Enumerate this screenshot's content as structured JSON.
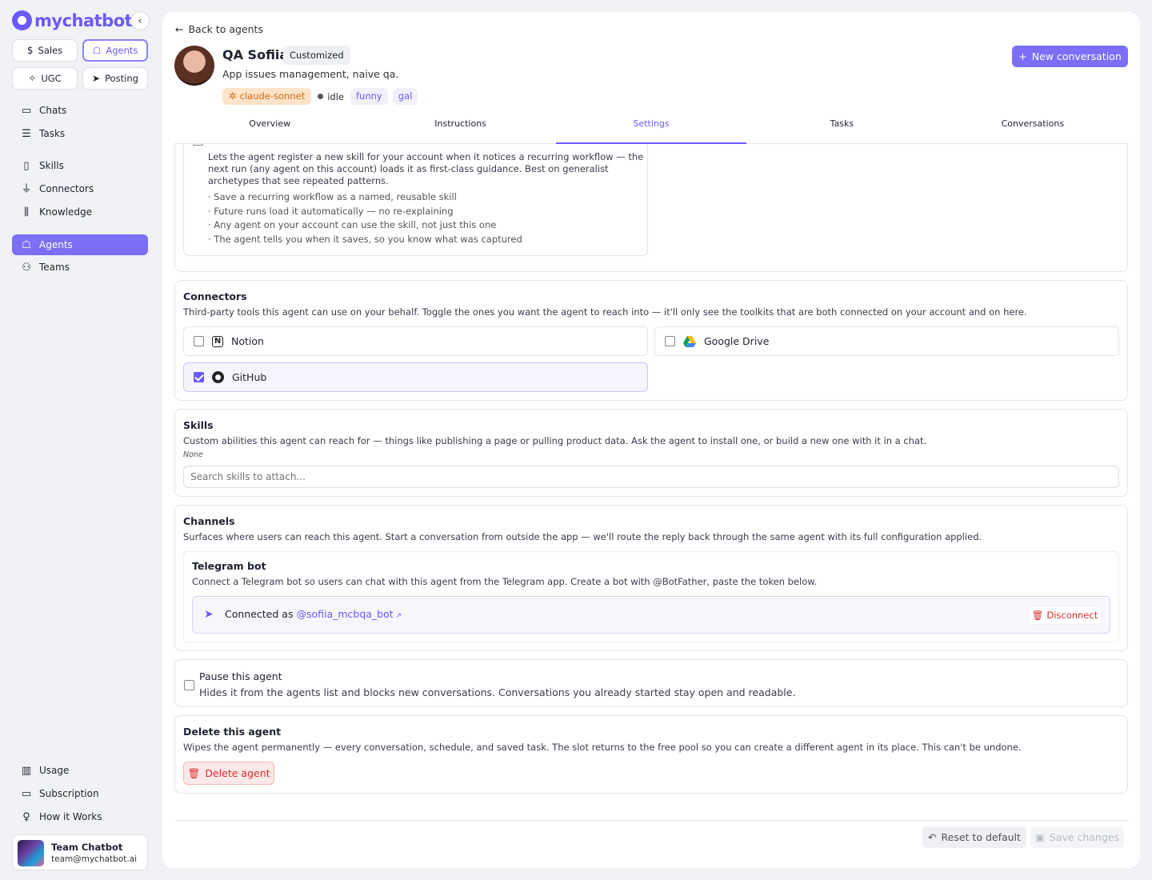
{
  "app": {
    "logo_text": "mychatbot"
  },
  "sidebar": {
    "quick": [
      {
        "label": "Sales",
        "icon": "dollar-icon"
      },
      {
        "label": "Agents",
        "icon": "robot-icon"
      },
      {
        "label": "UGC",
        "icon": "sparkles-icon"
      },
      {
        "label": "Posting",
        "icon": "send-icon"
      }
    ],
    "nav": [
      {
        "label": "Chats",
        "icon": "chat-icon"
      },
      {
        "label": "Tasks",
        "icon": "tasks-icon"
      },
      {
        "label": "Skills",
        "icon": "book-icon"
      },
      {
        "label": "Connectors",
        "icon": "plug-icon"
      },
      {
        "label": "Knowledge",
        "icon": "library-icon"
      },
      {
        "label": "Agents",
        "icon": "robot-icon"
      },
      {
        "label": "Teams",
        "icon": "users-icon"
      }
    ],
    "bottom": [
      {
        "label": "Usage",
        "icon": "bar-chart-icon"
      },
      {
        "label": "Subscription",
        "icon": "credit-card-icon"
      },
      {
        "label": "How it Works",
        "icon": "lightbulb-icon"
      }
    ],
    "profile": {
      "name": "Team Chatbot",
      "email": "team@mychatbot.ai"
    }
  },
  "header": {
    "back_label": "Back to agents",
    "agent_name": "QA Sofiia",
    "badge": "Customized",
    "description": "App issues management, naive qa.",
    "model": "claude-sonnet",
    "status": "idle",
    "tags": [
      "funny",
      "gal"
    ],
    "new_conversation": "New conversation"
  },
  "tabs": [
    "Overview",
    "Instructions",
    "Settings",
    "Tasks",
    "Conversations"
  ],
  "active_tab": "Settings",
  "self_skill": {
    "description": "Lets the agent register a new skill for your account when it notices a recurring workflow — the next run (any agent on this account) loads it as first-class guidance. Best on generalist archetypes that see repeated patterns.",
    "bullets": [
      "· Save a recurring workflow as a named, reusable skill",
      "· Future runs load it automatically — no re-explaining",
      "· Any agent on your account can use the skill, not just this one",
      "· The agent tells you when it saves, so you know what was captured"
    ]
  },
  "connectors": {
    "title": "Connectors",
    "description": "Third-party tools this agent can use on your behalf. Toggle the ones you want the agent to reach into — it'll only see the toolkits that are both connected on your account and on here.",
    "items": [
      {
        "label": "Notion",
        "checked": false
      },
      {
        "label": "Google Drive",
        "checked": false
      },
      {
        "label": "GitHub",
        "checked": true
      }
    ]
  },
  "skills": {
    "title": "Skills",
    "description": "Custom abilities this agent can reach for — things like publishing a page or pulling product data. Ask the agent to install one, or build a new one with it in a chat.",
    "empty": "None",
    "search_placeholder": "Search skills to attach..."
  },
  "channels": {
    "title": "Channels",
    "description": "Surfaces where users can reach this agent. Start a conversation from outside the app — we'll route the reply back through the same agent with its full configuration applied.",
    "telegram": {
      "title": "Telegram bot",
      "description": "Connect a Telegram bot so users can chat with this agent from the Telegram app. Create a bot with @BotFather, paste the token below.",
      "connected_prefix": "Connected as ",
      "handle": "@sofiia_mcbqa_bot",
      "disconnect": "Disconnect"
    }
  },
  "pause": {
    "title": "Pause this agent",
    "description": "Hides it from the agents list and blocks new conversations. Conversations you already started stay open and readable."
  },
  "delete": {
    "title": "Delete this agent",
    "description": "Wipes the agent permanently — every conversation, schedule, and saved task. The slot returns to the free pool so you can create a different agent in its place. This can't be undone.",
    "button": "Delete agent"
  },
  "footer": {
    "reset": "Reset to default",
    "save": "Save changes"
  }
}
